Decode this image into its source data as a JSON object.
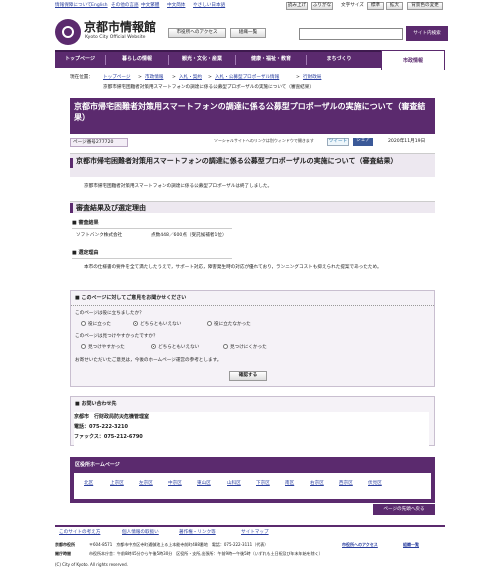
{
  "topbar": {
    "links": [
      "情報保障について",
      "English",
      "その他の言語",
      "中文繁體",
      "中文简体",
      "やさしい日本語"
    ],
    "right_links": [
      "読み上げ",
      "ふりがな"
    ],
    "font_size_label": "文字サイズ",
    "font_size_options": [
      "標準",
      "拡大"
    ],
    "theme_label": "背景色の変更"
  },
  "header": {
    "logo_text": "京都市情報館",
    "logo_sub": "Kyoto City Official Website",
    "access_button": "市役所へのアクセス",
    "sitemap_button": "組織一覧",
    "search_placeholder": "",
    "search_button": "サイト内検索"
  },
  "nav": {
    "items": [
      "トップページ",
      "暮らしの情報",
      "観光・文化・産業",
      "健康・福祉・教育",
      "まちづくり",
      "市政情報"
    ]
  },
  "breadcrumb": {
    "label": "現在位置：",
    "items": [
      "トップページ",
      "市政情報",
      "入札・契約",
      "入札・公募型プロポーザル情報",
      "行財政局"
    ],
    "current": "京都市帰宅困難者対策用スマートフォンの調達に係る公募型プロポーザルの実施について（審査結果）"
  },
  "page": {
    "title": "京都市帰宅困難者対策用スマートフォンの調達に係る公募型プロポーザルの実施について（審査結果）",
    "page_id": "ページ番号277720",
    "social_note": "ソーシャルサイトへのリンクは別ウィンドウで開きます",
    "tweet": "ツイート",
    "share": "シェア",
    "date": "2020年11月19日"
  },
  "section1": {
    "heading": "京都市帰宅困難者対策用スマートフォンの調達に係る公募型プロポーザルの実施について（審査結果）",
    "body": "京都市帰宅困難者対策用スマートフォンの調達に係る公募型プロポーザルは終了しました。"
  },
  "section2": {
    "heading": "審査結果及び選定理由",
    "sub1": "審査結果",
    "result_company": "ソフトバンク株式会社",
    "result_score": "点数448／600点（受託候補者1位）",
    "sub2": "選定理由",
    "reason": "本市の仕様書の要件を全て満たしたうえで，サポート対応，障害発生時の対応が優れており，ランニングコストも抑えられた提案であったため。"
  },
  "feedback": {
    "heading": "このページに対してご意見をお聞かせください",
    "q1": "このページは役に立ちましたか？",
    "q1_options": [
      "役に立った",
      "どちらともいえない",
      "役に立たなかった"
    ],
    "q1_selected": 1,
    "q2": "このページは見つけやすかったですか？",
    "q2_options": [
      "見つけやすかった",
      "どちらともいえない",
      "見つけにくかった"
    ],
    "q2_selected": 1,
    "note": "お寄せいただいたご意見は，今後のホームページ運営の参考とします。",
    "submit": "確認する"
  },
  "contact": {
    "heading": "お問い合わせ先",
    "org": "京都市　行財政局防災危機管理室",
    "tel": "電話：075-222-3210",
    "fax": "ファックス：075-212-6790"
  },
  "wards": {
    "heading": "区役所ホームページ",
    "items": [
      "北区",
      "上京区",
      "左京区",
      "中京区",
      "東山区",
      "山科区",
      "下京区",
      "南区",
      "右京区",
      "西京区",
      "伏見区"
    ]
  },
  "page_top": "ページの先頭へ戻る",
  "footer": {
    "links": [
      "このサイトの考え方",
      "個人情報の取扱い",
      "著作権・リンク等",
      "サイトマップ"
    ],
    "office_label": "京都市役所",
    "address": "〒604-8571　京都市中京区寺町通御池上る上本能寺前町488番地　電話：075-222-3111（代表）",
    "access_link": "市役所へのアクセス",
    "org_link": "組織一覧",
    "hours_label": "開庁時間",
    "hours": "市役所本庁舎：午前8時45分から午後5時30分　区役所・支所,出張所：午前9時～午後5時（いずれも土日祝及び年末年始を除く）",
    "copyright": "(C) City of Kyoto. All rights reserved."
  }
}
